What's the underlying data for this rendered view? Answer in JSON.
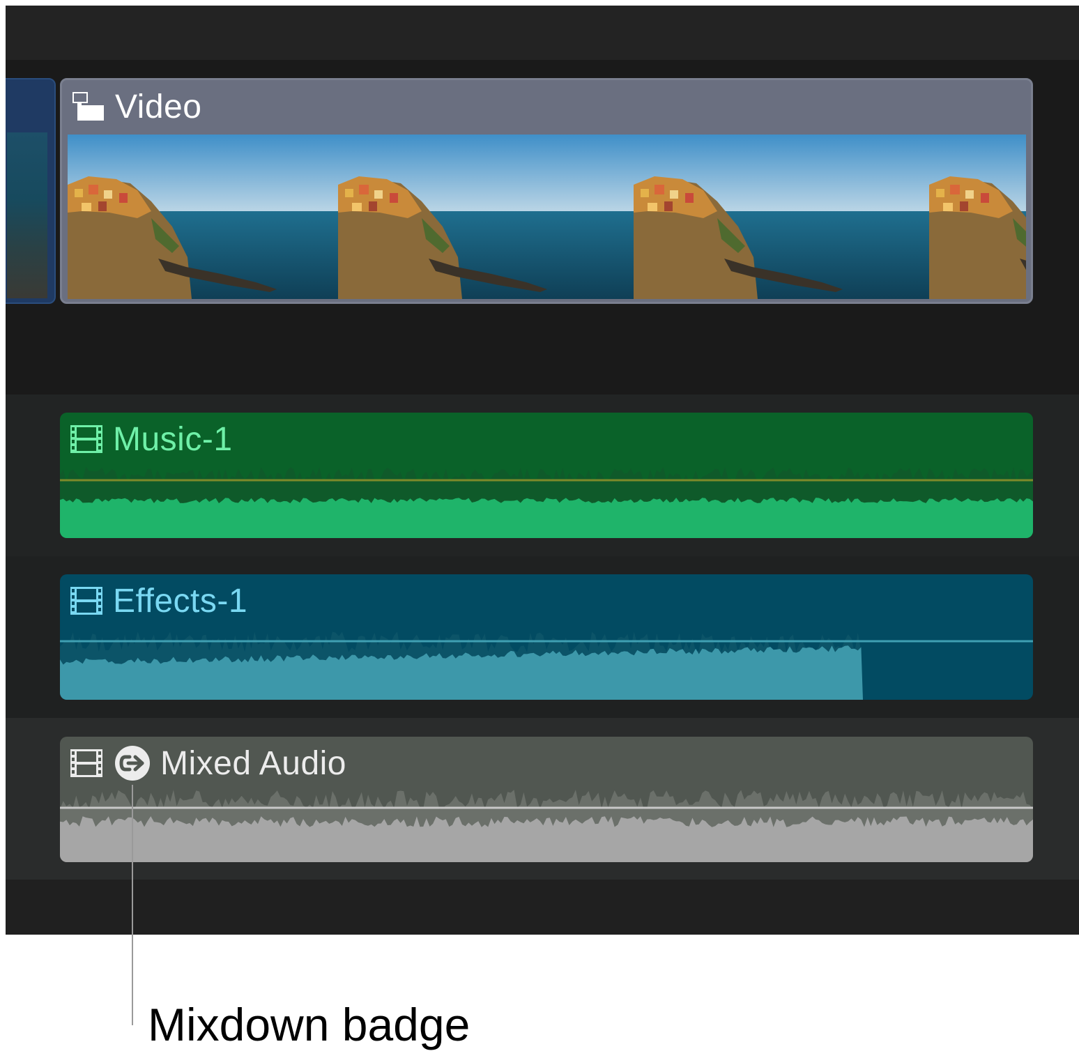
{
  "colors": {
    "video_title": "#ffffff",
    "music_title": "#6ff0a8",
    "effects_title": "#7ad8f2",
    "mixed_title": "#ececec",
    "music_wave": "#1fb46a",
    "effects_wave": "#3d98aa",
    "mixed_wave": "#a6a6a6"
  },
  "clips": {
    "video": {
      "title": "Video",
      "icon": "connected-clip-icon"
    },
    "music": {
      "title": "Music-1",
      "icon": "filmstrip-icon"
    },
    "effects": {
      "title": "Effects-1",
      "icon": "filmstrip-icon"
    },
    "mixed": {
      "title": "Mixed Audio",
      "icon": "filmstrip-icon",
      "badge_icon": "mixdown-badge-icon"
    }
  },
  "callout": {
    "label": "Mixdown badge"
  }
}
